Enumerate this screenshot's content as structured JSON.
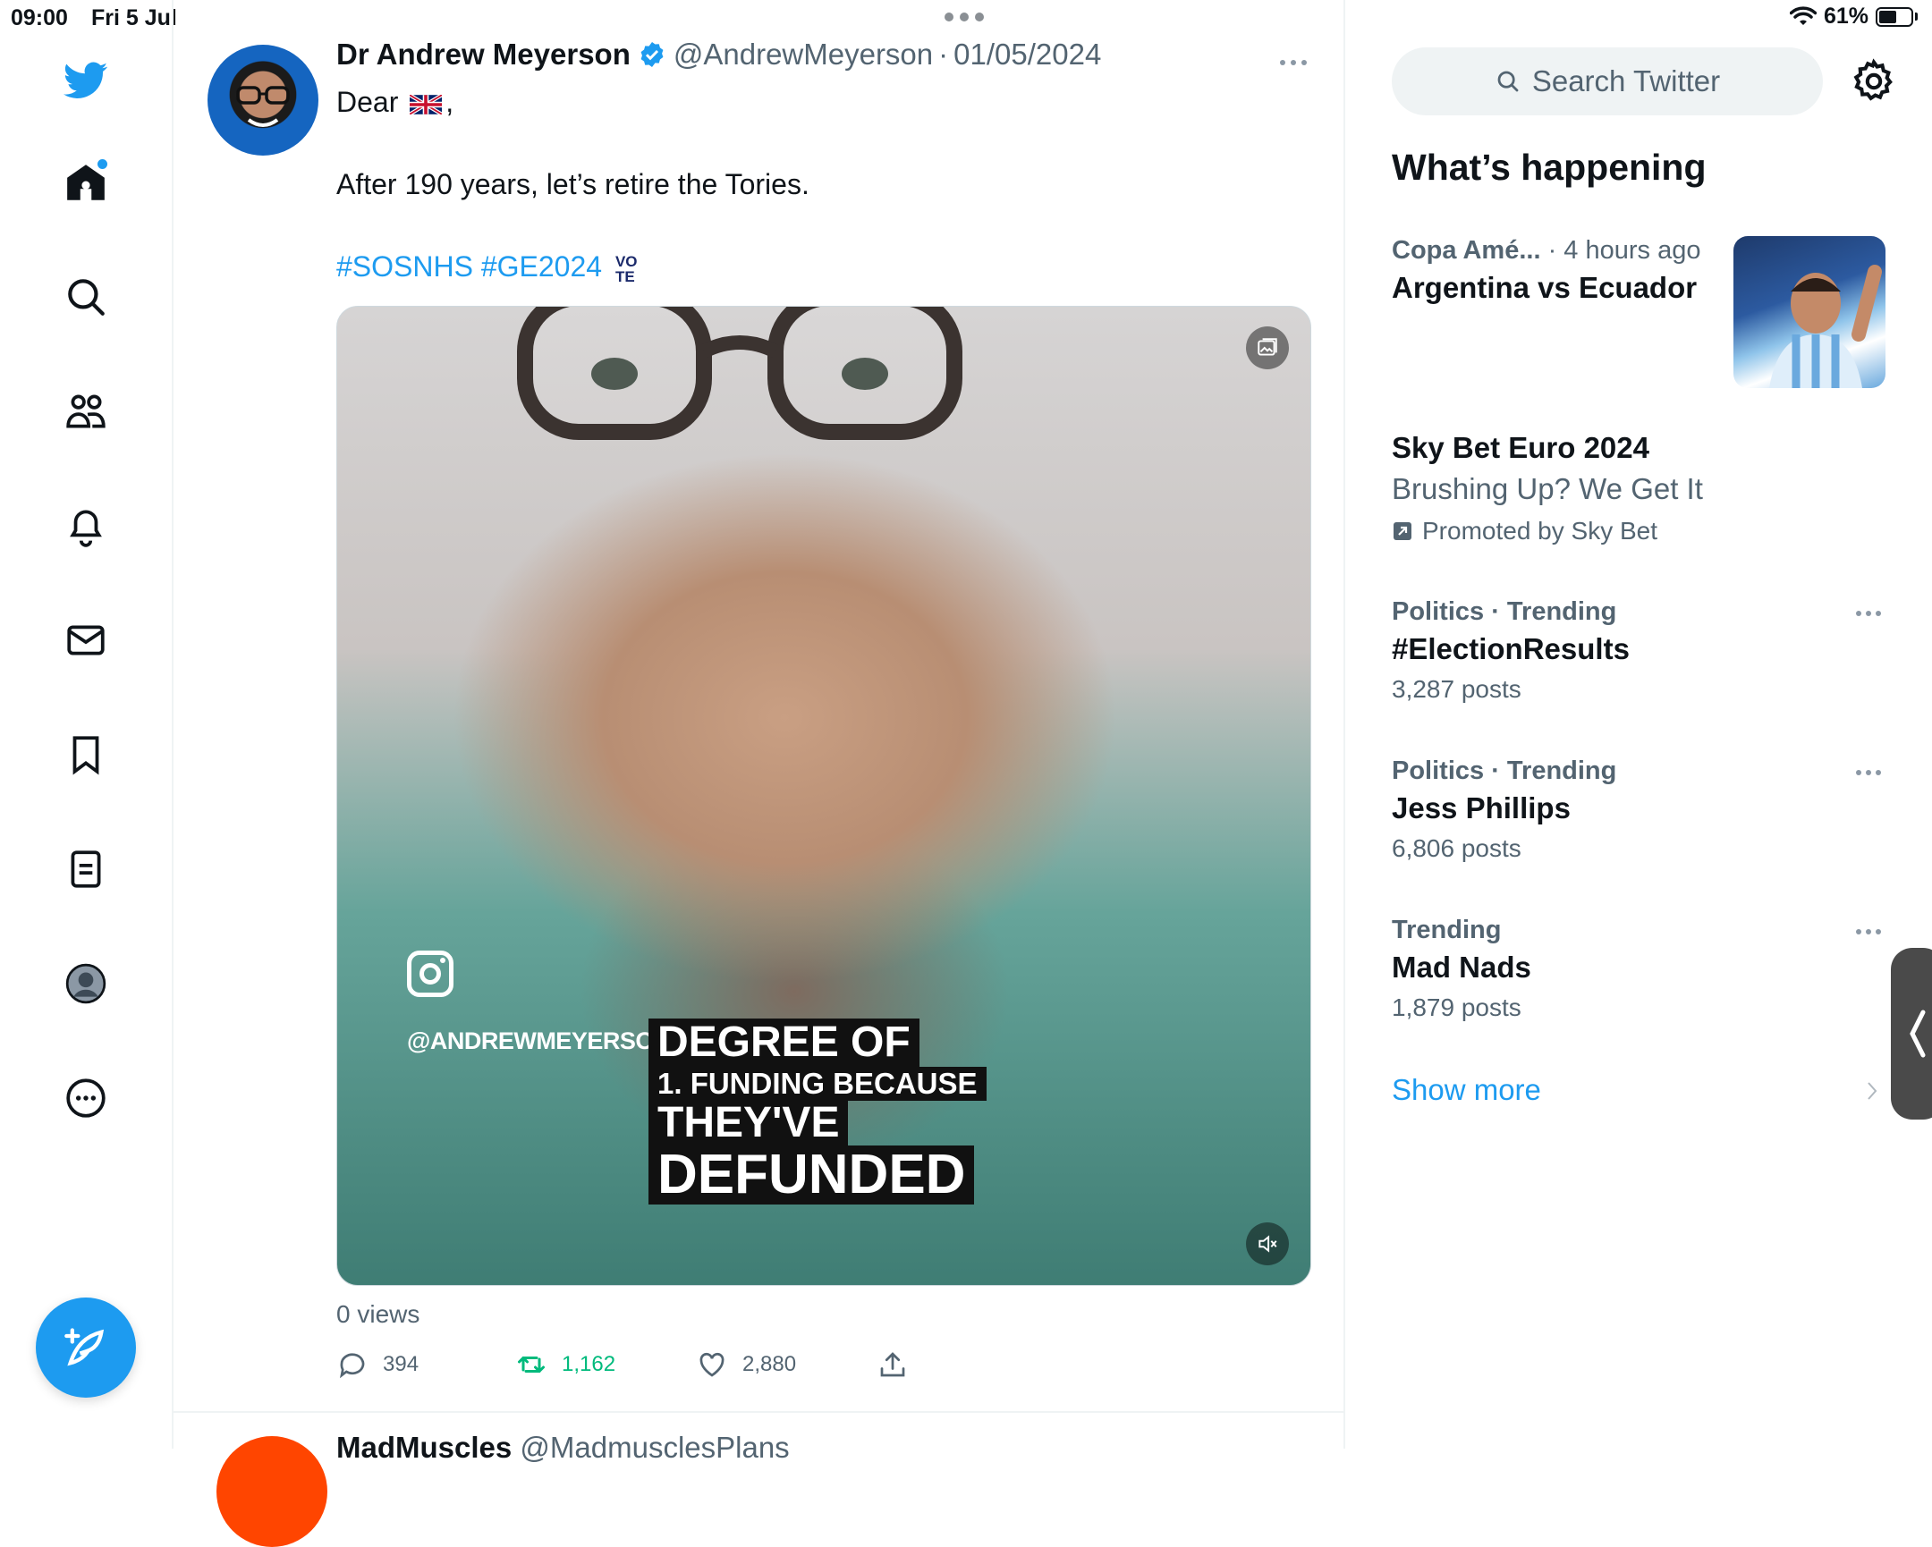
{
  "status": {
    "time": "09:00",
    "date": "Fri 5 Jul",
    "battery": "61%",
    "battery_level": 0.61
  },
  "tweet": {
    "author_name": "Dr Andrew Meyerson",
    "handle": "@AndrewMeyerson",
    "separator": "·",
    "date": "01/05/2024",
    "text_line1_prefix": "Dear",
    "text_line1_suffix": ",",
    "text_line2": "After 190 years, let’s retire the Tories.",
    "hashtag1": "#SOSNHS",
    "hashtag2": "#GE2024",
    "vote_top": "VO",
    "vote_bottom": "TE",
    "media": {
      "insta_handle": "@ANDREWMEYERSON",
      "caption_lines": [
        "DEGREE OF",
        "1. FUNDING BECAUSE",
        "THEY'VE",
        "DEFUNDED"
      ]
    },
    "views": "0 views",
    "replies": "394",
    "retweets": "1,162",
    "likes": "2,880"
  },
  "next_tweet": {
    "author_name": "MadMuscles",
    "handle": "@MadmusclesPlans"
  },
  "sidebar": {
    "search_placeholder": "Search Twitter",
    "whats_happening_title": "What’s happening",
    "trends": [
      {
        "category": "Copa Amé...",
        "time": "· 4 hours ago",
        "title": "Argentina vs Ecuador"
      },
      {
        "title": "Sky Bet Euro 2024",
        "subtitle": "Brushing Up? We Get It",
        "promoted_by": "Promoted by Sky Bet"
      },
      {
        "category": "Politics · Trending",
        "title": "#ElectionResults",
        "count": "3,287 posts"
      },
      {
        "category": "Politics · Trending",
        "title": "Jess Phillips",
        "count": "6,806 posts"
      },
      {
        "category": "Trending",
        "title": "Mad Nads",
        "count": "1,879 posts"
      }
    ],
    "show_more": "Show more"
  },
  "colors": {
    "accent": "#1d9bf0",
    "retweet_green": "#00ba7c",
    "muted_text": "#536471"
  }
}
